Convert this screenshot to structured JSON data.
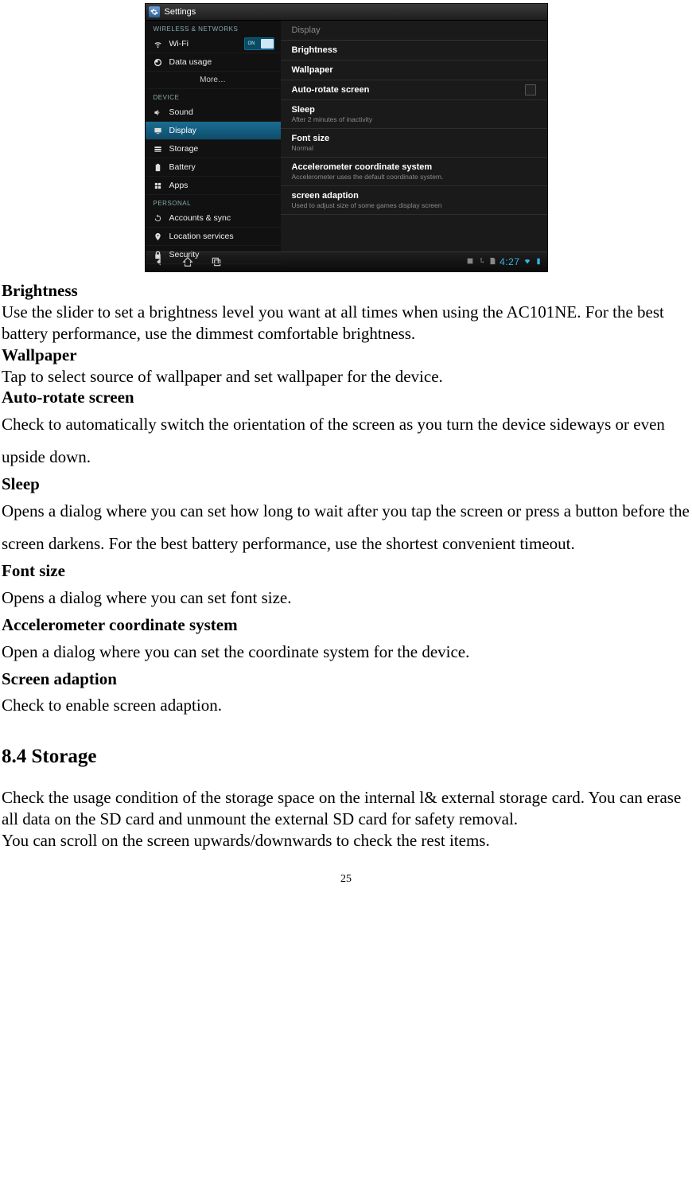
{
  "screenshot": {
    "titlebar": {
      "title": "Settings"
    },
    "sidebar": {
      "section_wireless": "WIRELESS & NETWORKS",
      "wifi": "Wi-Fi",
      "wifi_toggle": "ON",
      "data_usage": "Data usage",
      "more": "More…",
      "section_device": "DEVICE",
      "sound": "Sound",
      "display": "Display",
      "storage": "Storage",
      "battery": "Battery",
      "apps": "Apps",
      "section_personal": "PERSONAL",
      "accounts": "Accounts & sync",
      "location": "Location services",
      "security": "Security"
    },
    "detail": {
      "header": "Display",
      "brightness": "Brightness",
      "wallpaper": "Wallpaper",
      "autorotate": "Auto-rotate screen",
      "sleep_t": "Sleep",
      "sleep_s": "After 2 minutes of inactivity",
      "font_t": "Font size",
      "font_s": "Normal",
      "accel_t": "Accelerometer coordinate system",
      "accel_s": "Accelerometer uses the default coordinate system.",
      "adapt_t": "screen adaption",
      "adapt_s": "Used to adjust size of some games display screen"
    },
    "navbar": {
      "clock": "4:27"
    }
  },
  "doc": {
    "brightness_h": "Brightness",
    "brightness_p": "Use the slider to set a brightness level you want at all times when using the AC101NE. For the best battery performance, use the dimmest comfortable brightness.",
    "wallpaper_h": "Wallpaper",
    "wallpaper_p": "Tap to select source of wallpaper and set wallpaper for the device.",
    "autorotate_h": "Auto-rotate screen",
    "autorotate_p": "Check to automatically switch the orientation of the screen as you turn the device sideways or even upside down.",
    "sleep_h": "Sleep",
    "sleep_p": "Opens a dialog where you can set how long to wait after you tap the screen or press a button before the screen darkens. For the best battery performance, use the shortest convenient timeout.",
    "font_h": "Font size",
    "font_p": "Opens a dialog where you can set font size.",
    "accel_h": "Accelerometer coordinate system",
    "accel_p": "Open a dialog where you can set the coordinate system for the device.",
    "adapt_h": "Screen adaption",
    "adapt_p": "Check to enable screen adaption.",
    "storage_section": "8.4 Storage",
    "storage_p1": "Check the usage condition of the storage space on the internal l& external storage card. You can erase all data on the SD card and unmount the external SD card for safety removal.",
    "storage_p2": "You can scroll on the screen upwards/downwards to check the rest items.",
    "page_number": "25"
  }
}
